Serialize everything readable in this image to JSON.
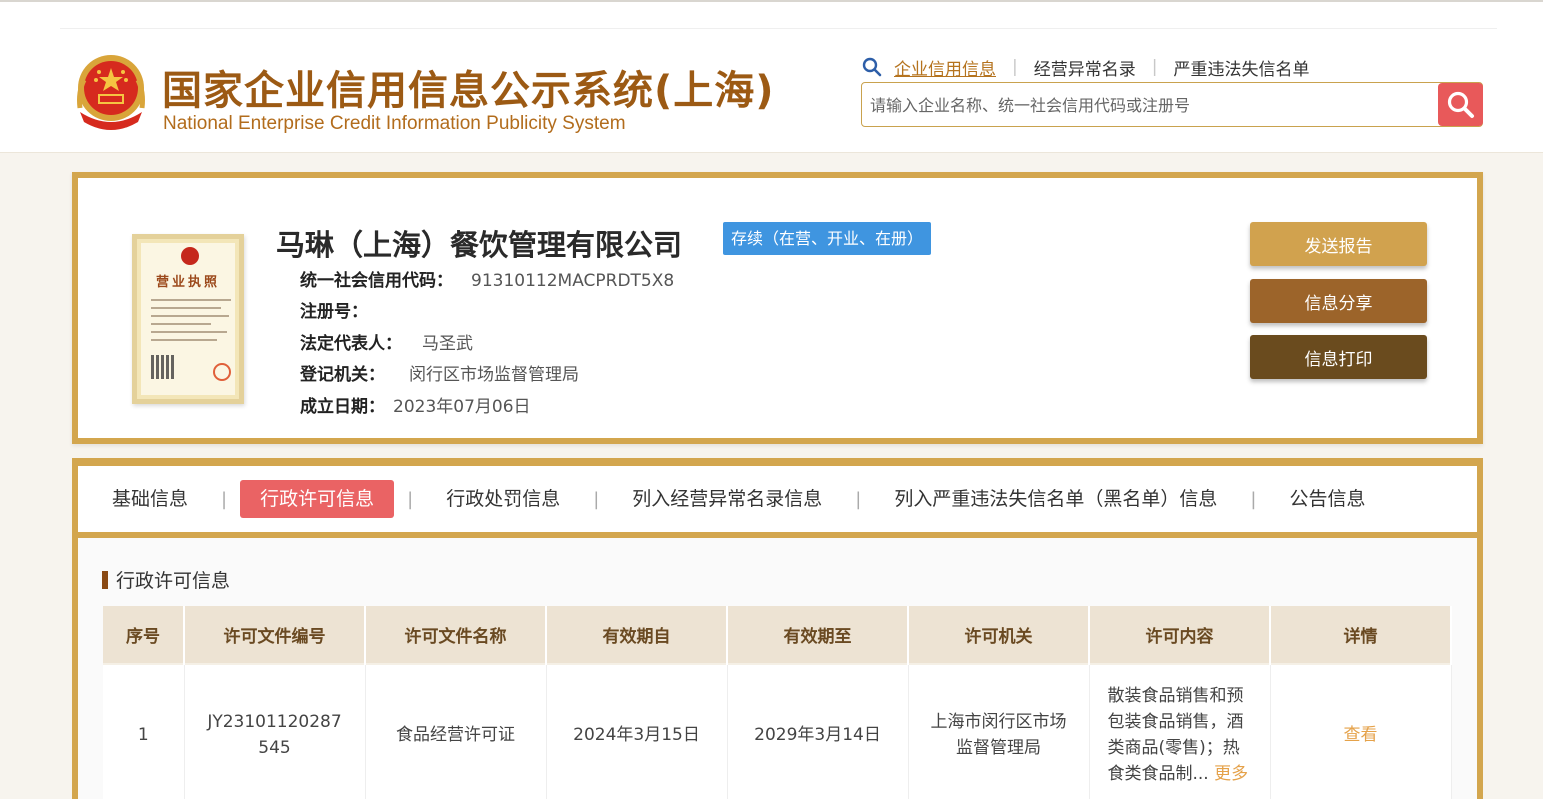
{
  "header": {
    "title_cn": "国家企业信用信息公示系统(上海)",
    "title_en": "National Enterprise Credit Information Publicity System",
    "nav": [
      {
        "label": "企业信用信息",
        "active": true
      },
      {
        "label": "经营异常名录",
        "active": false
      },
      {
        "label": "严重违法失信名单",
        "active": false
      }
    ],
    "search_placeholder": "请输入企业名称、统一社会信用代码或注册号"
  },
  "company": {
    "name": "马琳（上海）餐饮管理有限公司",
    "status": "存续（在营、开业、在册）",
    "license_title": "营业执照",
    "fields": [
      {
        "label": "统一社会信用代码：",
        "value": "91310112MACPRDT5X8"
      },
      {
        "label": "注册号：",
        "value": ""
      },
      {
        "label": "法定代表人：",
        "value": "马圣武"
      },
      {
        "label": "登记机关：",
        "value": "闵行区市场监督管理局"
      },
      {
        "label": "成立日期：",
        "value": "2023年07月06日"
      }
    ],
    "buttons": {
      "send": "发送报告",
      "share": "信息分享",
      "print": "信息打印"
    }
  },
  "tabs": [
    {
      "label": "基础信息",
      "active": false
    },
    {
      "label": "行政许可信息",
      "active": true
    },
    {
      "label": "行政处罚信息",
      "active": false
    },
    {
      "label": "列入经营异常名录信息",
      "active": false
    },
    {
      "label": "列入严重违法失信名单（黑名单）信息",
      "active": false
    },
    {
      "label": "公告信息",
      "active": false
    }
  ],
  "section": {
    "title": "行政许可信息",
    "columns": [
      "序号",
      "许可文件编号",
      "许可文件名称",
      "有效期自",
      "有效期至",
      "许可机关",
      "许可内容",
      "详情"
    ],
    "rows": [
      {
        "no": "1",
        "doc_no": "JY23101120287545",
        "doc_name": "食品经营许可证",
        "valid_from": "2024年3月15日",
        "valid_to": "2029年3月14日",
        "authority": "上海市闵行区市场监督管理局",
        "content": "散装食品销售和预包装食品销售，酒类商品(零售)；热食类食品制...",
        "more": "更多",
        "detail": "查看"
      }
    ]
  },
  "colors": {
    "accent": "#d3a64e",
    "active_tab": "#ea6364",
    "status": "#3f95e0",
    "search_btn": "#e8595a"
  }
}
